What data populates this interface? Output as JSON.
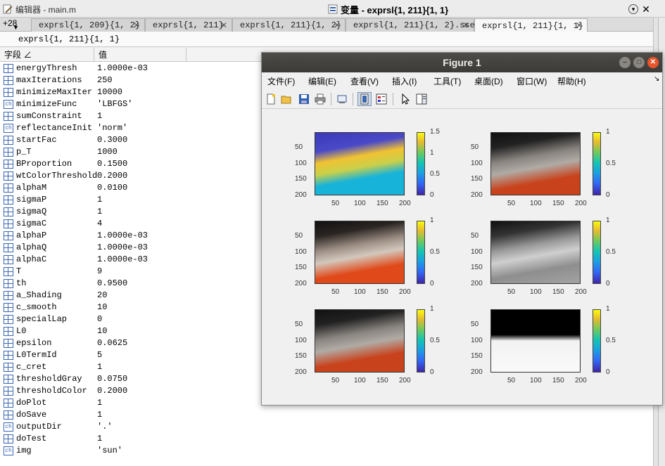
{
  "editor": {
    "title": "编辑器 - main.m"
  },
  "variables": {
    "title": "变量 - exprsl{1, 211}{1, 1}"
  },
  "tabs": {
    "count": "+28",
    "items": [
      {
        "label": "exprsl{1, 209}{1, 2}"
      },
      {
        "label": "exprsl{1, 211}"
      },
      {
        "label": "exprsl{1, 211}{1, 2}"
      },
      {
        "label": "exprsl{1, 211}{1, 2}.sse"
      },
      {
        "label": "exprsl{1, 211}{1, 1}"
      }
    ]
  },
  "path": "exprsl{1, 211}{1, 1}",
  "table": {
    "headers": {
      "field": "字段 ∠",
      "value": "值"
    },
    "rows": [
      {
        "field": "energyThresh",
        "value": "1.0000e-03",
        "icon": "numeric-icon"
      },
      {
        "field": "maxIterations",
        "value": "250",
        "icon": "numeric-icon"
      },
      {
        "field": "minimizeMaxIter",
        "value": "10000",
        "icon": "numeric-icon"
      },
      {
        "field": "minimizeFunc",
        "value": "'LBFGS'",
        "icon": "char-icon"
      },
      {
        "field": "sumConstraint",
        "value": "1",
        "icon": "numeric-icon"
      },
      {
        "field": "reflectanceInit",
        "value": "'norm'",
        "icon": "char-icon"
      },
      {
        "field": "startFac",
        "value": "0.3000",
        "icon": "numeric-icon"
      },
      {
        "field": "p_T",
        "value": "1000",
        "icon": "numeric-icon"
      },
      {
        "field": "BProportion",
        "value": "0.1500",
        "icon": "numeric-icon"
      },
      {
        "field": "wtColorThreshold",
        "value": "0.2000",
        "icon": "numeric-icon"
      },
      {
        "field": "alphaM",
        "value": "0.0100",
        "icon": "numeric-icon"
      },
      {
        "field": "sigmaP",
        "value": "1",
        "icon": "numeric-icon"
      },
      {
        "field": "sigmaQ",
        "value": "1",
        "icon": "numeric-icon"
      },
      {
        "field": "sigmaC",
        "value": "4",
        "icon": "numeric-icon"
      },
      {
        "field": "alphaP",
        "value": "1.0000e-03",
        "icon": "numeric-icon"
      },
      {
        "field": "alphaQ",
        "value": "1.0000e-03",
        "icon": "numeric-icon"
      },
      {
        "field": "alphaC",
        "value": "1.0000e-03",
        "icon": "numeric-icon"
      },
      {
        "field": "T",
        "value": "9",
        "icon": "numeric-icon"
      },
      {
        "field": "th",
        "value": "0.9500",
        "icon": "numeric-icon"
      },
      {
        "field": "a_Shading",
        "value": "20",
        "icon": "numeric-icon"
      },
      {
        "field": "c_smooth",
        "value": "10",
        "icon": "numeric-icon"
      },
      {
        "field": "specialLap",
        "value": "0",
        "icon": "numeric-icon"
      },
      {
        "field": "L0",
        "value": "10",
        "icon": "numeric-icon"
      },
      {
        "field": "epsilon",
        "value": "0.0625",
        "icon": "numeric-icon"
      },
      {
        "field": "L0TermId",
        "value": "5",
        "icon": "numeric-icon"
      },
      {
        "field": "c_cret",
        "value": "1",
        "icon": "numeric-icon"
      },
      {
        "field": "thresholdGray",
        "value": "0.0750",
        "icon": "numeric-icon"
      },
      {
        "field": "thresholdColor",
        "value": "0.2000",
        "icon": "numeric-icon"
      },
      {
        "field": "doPlot",
        "value": "1",
        "icon": "numeric-icon"
      },
      {
        "field": "doSave",
        "value": "1",
        "icon": "numeric-icon"
      },
      {
        "field": "outputDir",
        "value": "'.'",
        "icon": "char-icon"
      },
      {
        "field": "doTest",
        "value": "1",
        "icon": "numeric-icon"
      },
      {
        "field": "img",
        "value": "'sun'",
        "icon": "char-icon"
      }
    ]
  },
  "figure": {
    "title": "Figure 1",
    "menu": [
      "文件(F)",
      "编辑(E)",
      "查看(V)",
      "插入(I)",
      "工具(T)",
      "桌面(D)",
      "窗口(W)",
      "帮助(H)"
    ],
    "toolbar_icons": [
      "new-figure-icon",
      "open-file-icon",
      "save-icon",
      "print-icon",
      "link-icon",
      "figure-panel-icon",
      "insert-colorbar-icon",
      "pointer-icon",
      "property-editor-icon"
    ],
    "axes_ticks": {
      "x": [
        "50",
        "100",
        "150",
        "200"
      ],
      "y": [
        "50",
        "100",
        "150",
        "200"
      ]
    },
    "colorbars": [
      [
        "1.5",
        "1",
        "0.5",
        "0"
      ],
      [
        "1",
        "0.5",
        "0"
      ],
      [
        "1",
        "0.5",
        "0"
      ],
      [
        "1",
        "0.5",
        "0"
      ],
      [
        "1",
        "0.5",
        "0"
      ],
      [
        "1",
        "0.5",
        "0"
      ]
    ]
  }
}
